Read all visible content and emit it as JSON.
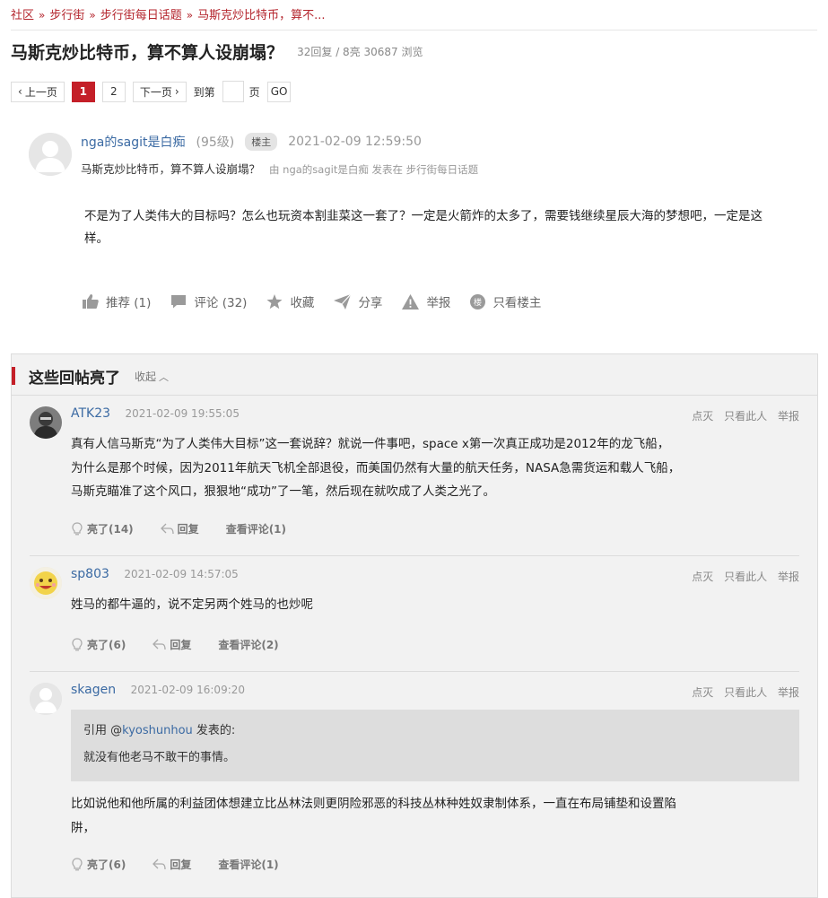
{
  "breadcrumb": [
    "社区",
    "步行街",
    "步行街每日话题",
    "马斯克炒比特币，算不..."
  ],
  "thread": {
    "title": "马斯克炒比特币，算不算人设崩塌？",
    "meta": "32回复 / 8亮 30687 浏览"
  },
  "pager": {
    "prev": "上一页",
    "pages": [
      "1",
      "2"
    ],
    "next": "下一页",
    "goto_prefix": "到第",
    "goto_suffix": "页",
    "go": "GO"
  },
  "op": {
    "author": "nga的sagit是白痴",
    "level": "(95级)",
    "badge": "楼主",
    "time": "2021-02-09 12:59:50",
    "subtitle": "马斯克炒比特币，算不算人设崩塌？",
    "source": "由  nga的sagit是白痴 发表在  步行街每日话题",
    "body": "不是为了人类伟大的目标吗？怎么也玩资本割韭菜这一套了？一定是火箭炸的太多了，需要钱继续星辰大海的梦想吧，一定是这样。",
    "actions": {
      "recommend": "推荐 (1)",
      "comment": "评论 (32)",
      "favorite": "收藏",
      "share": "分享",
      "report": "举报",
      "only_op": "只看楼主"
    }
  },
  "hot": {
    "title": "这些回帖亮了",
    "fold": "收起",
    "tools": {
      "dim": "点灭",
      "only_this": "只看此人",
      "report": "举报"
    },
    "replies": [
      {
        "author": "ATK23",
        "time": "2021-02-09 19:55:05",
        "body": "真有人信马斯克“为了人类伟大目标”这一套说辞？就说一件事吧，space x第一次真正成功是2012年的龙飞船，为什么是那个时候，因为2011年航天飞机全部退役，而美国仍然有大量的航天任务，NASA急需货运和载人飞船，马斯克瞄准了这个风口，狠狠地“成功”了一笔，然后现在就吹成了人类之光了。",
        "light": "亮了(14)",
        "reply": "回复",
        "comments": "查看评论(1)"
      },
      {
        "author": "sp803",
        "time": "2021-02-09 14:57:05",
        "body": "姓马的都牛逼的，说不定另两个姓马的也炒呢",
        "light": "亮了(6)",
        "reply": "回复",
        "comments": "查看评论(2)"
      },
      {
        "author": "skagen",
        "time": "2021-02-09 16:09:20",
        "quote_prefix": "引用 @",
        "quote_user": "kyoshunhou",
        "quote_suffix": " 发表的:",
        "quote_text": "就没有他老马不敢干的事情。",
        "body": "比如说他和他所属的利益团体想建立比丛林法则更阴险邪恶的科技丛林种姓奴隶制体系，一直在布局铺垫和设置陷阱，",
        "light": "亮了(6)",
        "reply": "回复",
        "comments": "查看评论(1)"
      }
    ]
  },
  "colors": {
    "accent": "#c41f28",
    "link": "#3b6aa3",
    "muted": "#999999"
  },
  "icons": [
    "thumbs-up-icon",
    "comment-icon",
    "star-icon",
    "share-icon",
    "warning-icon",
    "op-icon",
    "lightbulb-icon",
    "reply-arrow-icon",
    "chevron-up-icon"
  ]
}
